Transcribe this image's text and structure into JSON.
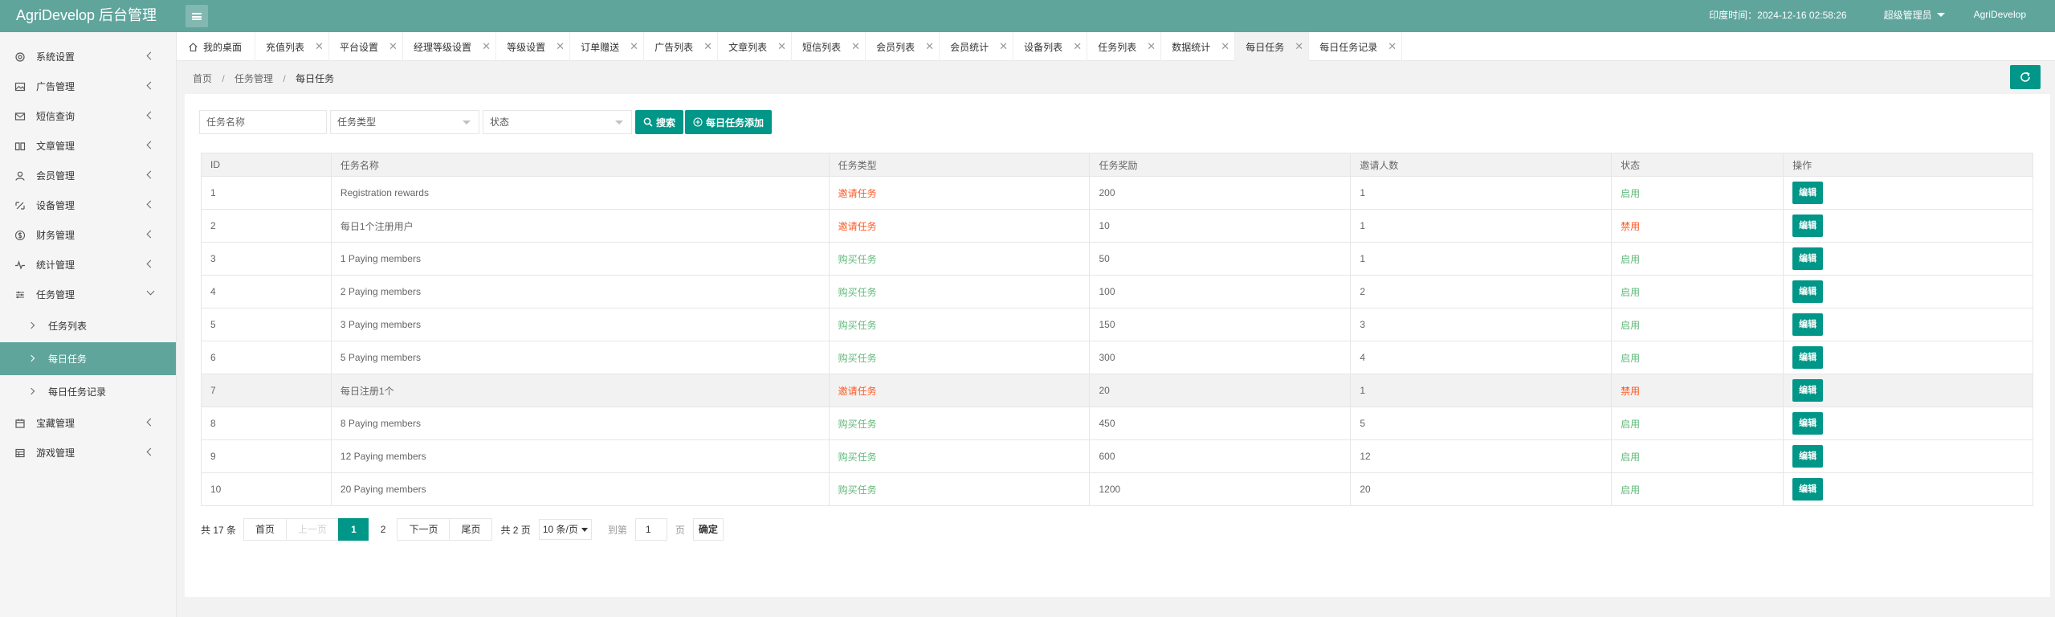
{
  "header": {
    "logo": "AgriDevelop 后台管理",
    "time_text": "印度时间：2024-12-16 02:58:26",
    "admin": "超级管理员",
    "user": "AgriDevelop"
  },
  "sidebar": {
    "items": [
      {
        "label": "系统设置",
        "icon": "gear-icon"
      },
      {
        "label": "广告管理",
        "icon": "image-icon"
      },
      {
        "label": "短信查询",
        "icon": "mail-icon"
      },
      {
        "label": "文章管理",
        "icon": "book-icon"
      },
      {
        "label": "会员管理",
        "icon": "user-icon"
      },
      {
        "label": "设备管理",
        "icon": "devices-icon"
      },
      {
        "label": "财务管理",
        "icon": "dollar-icon"
      },
      {
        "label": "统计管理",
        "icon": "pulse-icon"
      },
      {
        "label": "任务管理",
        "icon": "sliders-icon"
      }
    ],
    "task_sub": [
      "任务列表",
      "每日任务",
      "每日任务记录"
    ],
    "items_after": [
      {
        "label": "宝藏管理",
        "icon": "calendar-icon"
      },
      {
        "label": "游戏管理",
        "icon": "table-icon"
      }
    ]
  },
  "tabs": {
    "home": "我的桌面",
    "items": [
      "充值列表",
      "平台设置",
      "经理等级设置",
      "等级设置",
      "订单赠送",
      "广告列表",
      "文章列表",
      "短信列表",
      "会员列表",
      "会员统计",
      "设备列表",
      "任务列表",
      "数据统计",
      "每日任务",
      "每日任务记录"
    ],
    "active": "每日任务",
    "close_glyph": "✕"
  },
  "breadcrumb": {
    "home": "首页",
    "parent": "任务管理",
    "current": "每日任务",
    "sep": "/"
  },
  "search": {
    "name_placeholder": "任务名称",
    "type_placeholder": "任务类型",
    "status_placeholder": "状态",
    "search_label": "搜索",
    "add_label": "每日任务添加"
  },
  "table": {
    "headers": [
      "ID",
      "任务名称",
      "任务类型",
      "任务奖励",
      "邀请人数",
      "状态",
      "操作"
    ],
    "edit_label": "编辑",
    "rows": [
      {
        "id": "1",
        "name": "Registration rewards",
        "type": "邀请任务",
        "type_color": "red",
        "reward": "200",
        "invites": "1",
        "status": "启用",
        "status_color": "green"
      },
      {
        "id": "2",
        "name": "每日1个注册用户",
        "type": "邀请任务",
        "type_color": "red",
        "reward": "10",
        "invites": "1",
        "status": "禁用",
        "status_color": "red"
      },
      {
        "id": "3",
        "name": "1 Paying members",
        "type": "购买任务",
        "type_color": "green",
        "reward": "50",
        "invites": "1",
        "status": "启用",
        "status_color": "green"
      },
      {
        "id": "4",
        "name": "2 Paying members",
        "type": "购买任务",
        "type_color": "green",
        "reward": "100",
        "invites": "2",
        "status": "启用",
        "status_color": "green"
      },
      {
        "id": "5",
        "name": "3 Paying members",
        "type": "购买任务",
        "type_color": "green",
        "reward": "150",
        "invites": "3",
        "status": "启用",
        "status_color": "green"
      },
      {
        "id": "6",
        "name": "5 Paying members",
        "type": "购买任务",
        "type_color": "green",
        "reward": "300",
        "invites": "4",
        "status": "启用",
        "status_color": "green"
      },
      {
        "id": "7",
        "name": "每日注册1个",
        "type": "邀请任务",
        "type_color": "red",
        "reward": "20",
        "invites": "1",
        "status": "禁用",
        "status_color": "red"
      },
      {
        "id": "8",
        "name": "8 Paying members",
        "type": "购买任务",
        "type_color": "green",
        "reward": "450",
        "invites": "5",
        "status": "启用",
        "status_color": "green"
      },
      {
        "id": "9",
        "name": "12 Paying members",
        "type": "购买任务",
        "type_color": "green",
        "reward": "600",
        "invites": "12",
        "status": "启用",
        "status_color": "green"
      },
      {
        "id": "10",
        "name": "20 Paying members",
        "type": "购买任务",
        "type_color": "green",
        "reward": "1200",
        "invites": "20",
        "status": "启用",
        "status_color": "green"
      }
    ]
  },
  "pager": {
    "count": "共 17 条",
    "first": "首页",
    "prev": "上一页",
    "pages": [
      "1",
      "2"
    ],
    "next": "下一页",
    "last": "尾页",
    "total": "共 2 页",
    "limit": "10 条/页",
    "goto": "到第",
    "goto_value": "1",
    "page_unit": "页",
    "confirm": "确定"
  },
  "colors": {
    "accent": "#009688",
    "header": "#5fa59c",
    "red": "#ff5722",
    "green": "#5fb878"
  }
}
